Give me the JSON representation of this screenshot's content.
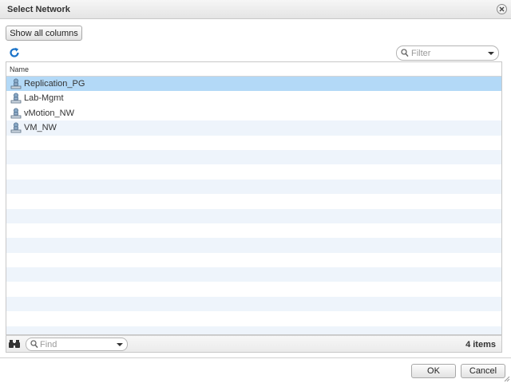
{
  "dialog": {
    "title": "Select Network"
  },
  "toolbar": {
    "show_columns_label": "Show all columns",
    "filter_placeholder": "Filter"
  },
  "table": {
    "column_name": "Name",
    "rows": [
      {
        "label": "Replication_PG",
        "selected": true
      },
      {
        "label": "Lab-Mgmt",
        "selected": false
      },
      {
        "label": "vMotion_NW",
        "selected": false
      },
      {
        "label": "VM_NW",
        "selected": false
      }
    ]
  },
  "footer": {
    "find_placeholder": "Find",
    "item_count": "4 items"
  },
  "buttons": {
    "ok_label": "OK",
    "cancel_label": "Cancel"
  },
  "icons": {
    "refresh": "refresh-icon",
    "network": "network-portgroup-icon",
    "find": "binoculars-icon",
    "close": "close-icon"
  },
  "colors": {
    "selected_row": "#b3d9f7",
    "alt_row": "#eef4fb",
    "accent": "#1a73c9"
  }
}
